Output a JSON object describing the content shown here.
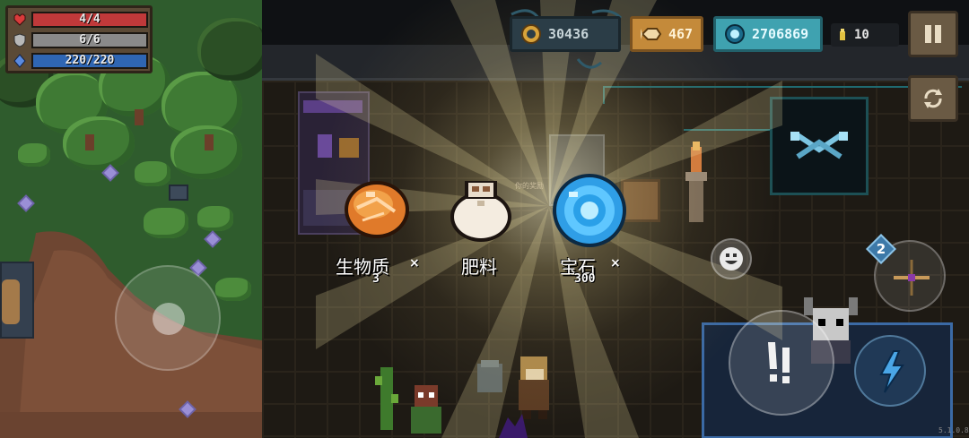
{
  "stats": {
    "health": {
      "text": "4/4",
      "fraction": 1.0,
      "color": "#c0393a",
      "icon": "heart-icon"
    },
    "armor": {
      "text": "6/6",
      "fraction": 1.0,
      "color": "#8a8a8a",
      "icon": "shield-icon"
    },
    "energy": {
      "text": "220/220",
      "fraction": 1.0,
      "color": "#2f66b3",
      "icon": "energy-crystal-icon"
    }
  },
  "currency": {
    "coins": {
      "value": "30436",
      "icon": "coin-icon"
    },
    "fish": {
      "value": "467",
      "icon": "fish-icon"
    },
    "gems": {
      "value": "2706869",
      "icon": "gem-icon"
    },
    "ammo": {
      "value": "10",
      "icon": "bullet-icon"
    }
  },
  "buttons": {
    "pause": {
      "icon": "pause-icon"
    },
    "swap": {
      "icon": "character-swap-icon"
    },
    "emote": {
      "icon": "smiley-icon"
    },
    "weapon": {
      "icon": "crossbow-icon",
      "count": "2"
    },
    "attack": {
      "icon": "attack-icon"
    },
    "skill": {
      "icon": "lightning-icon"
    }
  },
  "rewards": [
    {
      "label": "生物质",
      "multiplier": "×",
      "quantity": "3",
      "icon": "biomass-icon"
    },
    {
      "label": "肥料",
      "multiplier": "",
      "quantity": "",
      "icon": "fertilizer-bag-icon"
    },
    {
      "label": "宝石",
      "multiplier": "×",
      "quantity": "300",
      "icon": "blue-gem-icon"
    }
  ],
  "background_labels": {
    "faint_sign": "你的奖励"
  },
  "version": "5.1.0.8"
}
